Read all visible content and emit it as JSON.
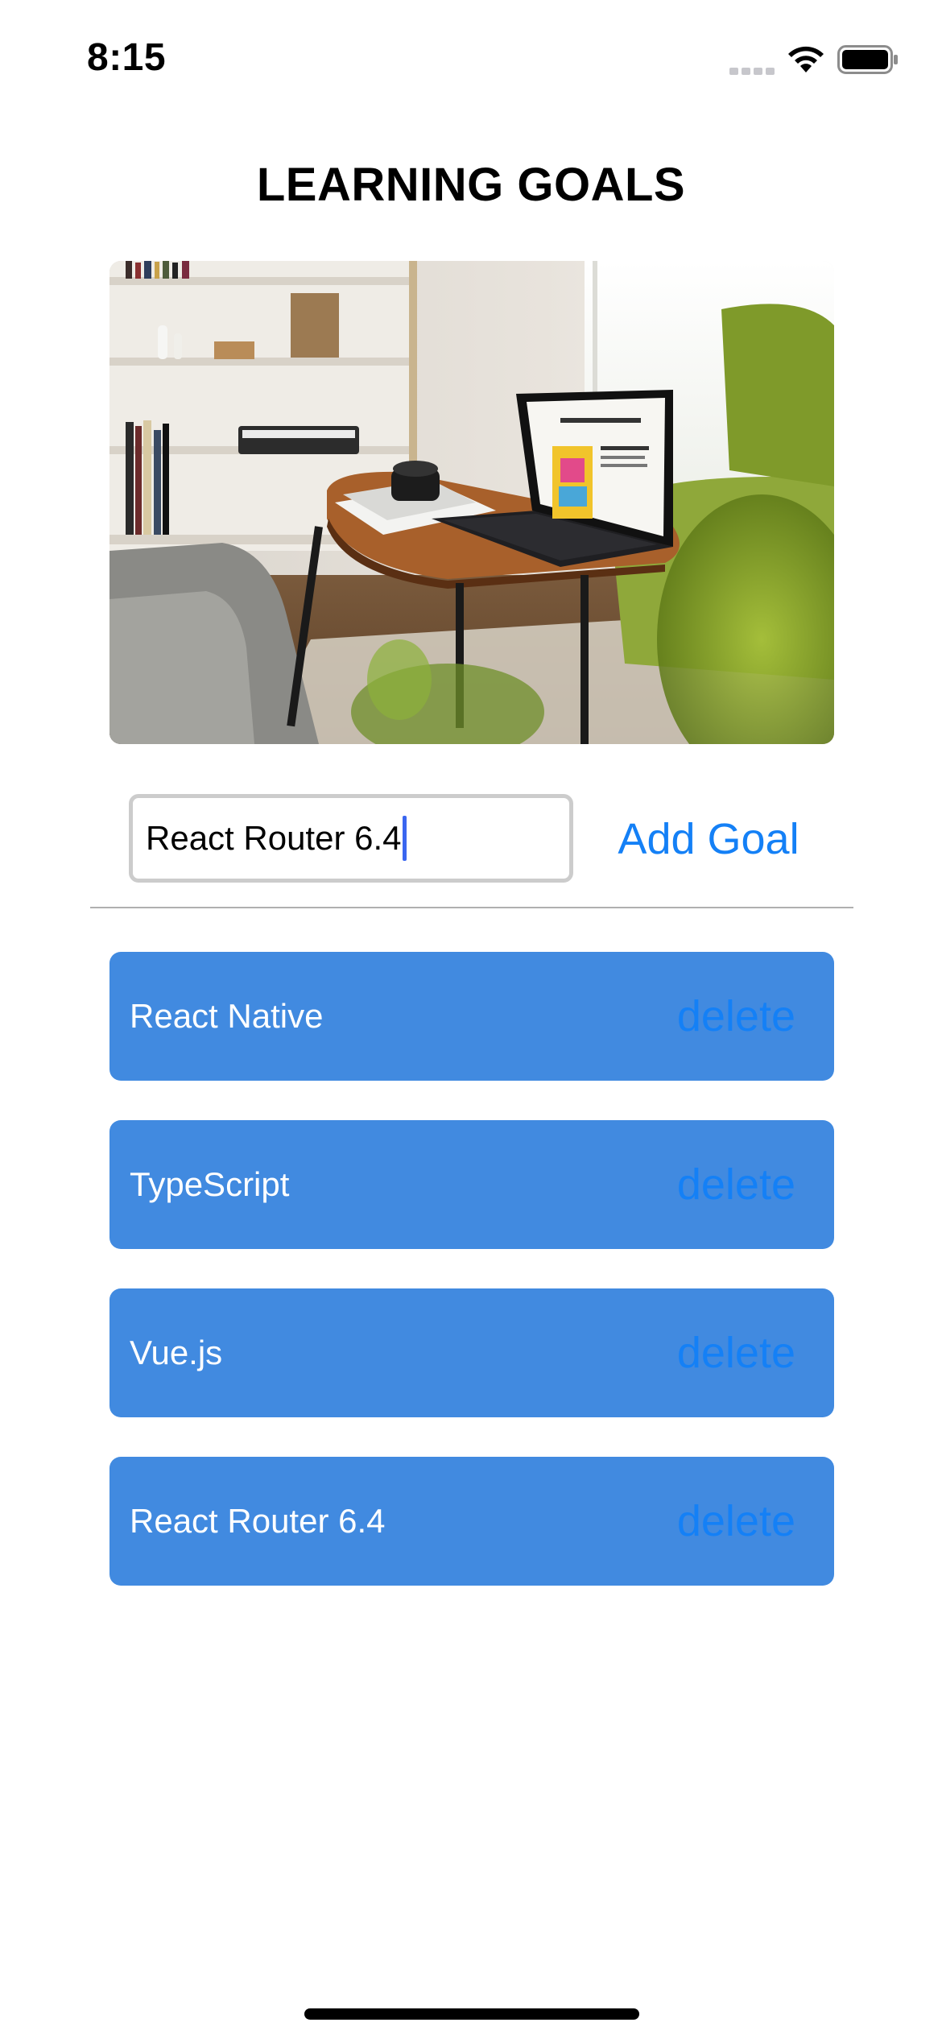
{
  "status_bar": {
    "time": "8:15"
  },
  "header": {
    "title": "LEARNING GOALS"
  },
  "hero_image": {
    "description": "living-room-with-laptop-photo"
  },
  "goal_input": {
    "value": "React Router 6.4",
    "add_button_label": "Add Goal"
  },
  "goals": [
    {
      "label": "React Native",
      "delete_label": "delete"
    },
    {
      "label": "TypeScript",
      "delete_label": "delete"
    },
    {
      "label": "Vue.js",
      "delete_label": "delete"
    },
    {
      "label": "React Router 6.4",
      "delete_label": "delete"
    }
  ],
  "colors": {
    "goal_item_bg": "#418ae0",
    "accent_blue": "#1480f6",
    "caret": "#3a66f0"
  }
}
